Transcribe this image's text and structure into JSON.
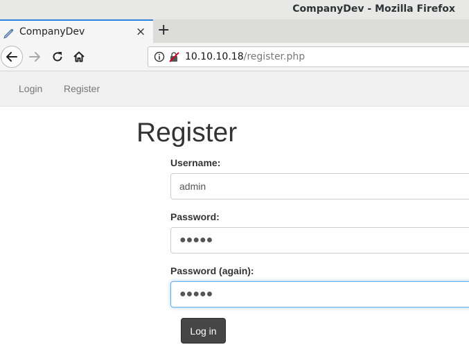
{
  "window": {
    "title": "CompanyDev - Mozilla Firefox"
  },
  "tab": {
    "title": "CompanyDev",
    "close_glyph": "×",
    "new_tab_glyph": "+"
  },
  "toolbar": {
    "url_host": "10.10.10.18",
    "url_path": "/register.php",
    "icons": [
      "back-icon",
      "forward-icon",
      "reload-icon",
      "home-icon",
      "info-icon",
      "insecure-lock-icon"
    ]
  },
  "site_nav": {
    "items": [
      {
        "label": "Login"
      },
      {
        "label": "Register"
      }
    ]
  },
  "form": {
    "heading": "Register",
    "username_label": "Username:",
    "username_value": "admin",
    "password_label": "Password:",
    "password_value": "●●●●●",
    "password_again_label": "Password (again):",
    "password_again_value": "●●●●●",
    "submit_label": "Log in"
  },
  "colors": {
    "tab_accent": "#2b82d9",
    "button_bg": "#464646",
    "focus_border": "#66afe9"
  }
}
